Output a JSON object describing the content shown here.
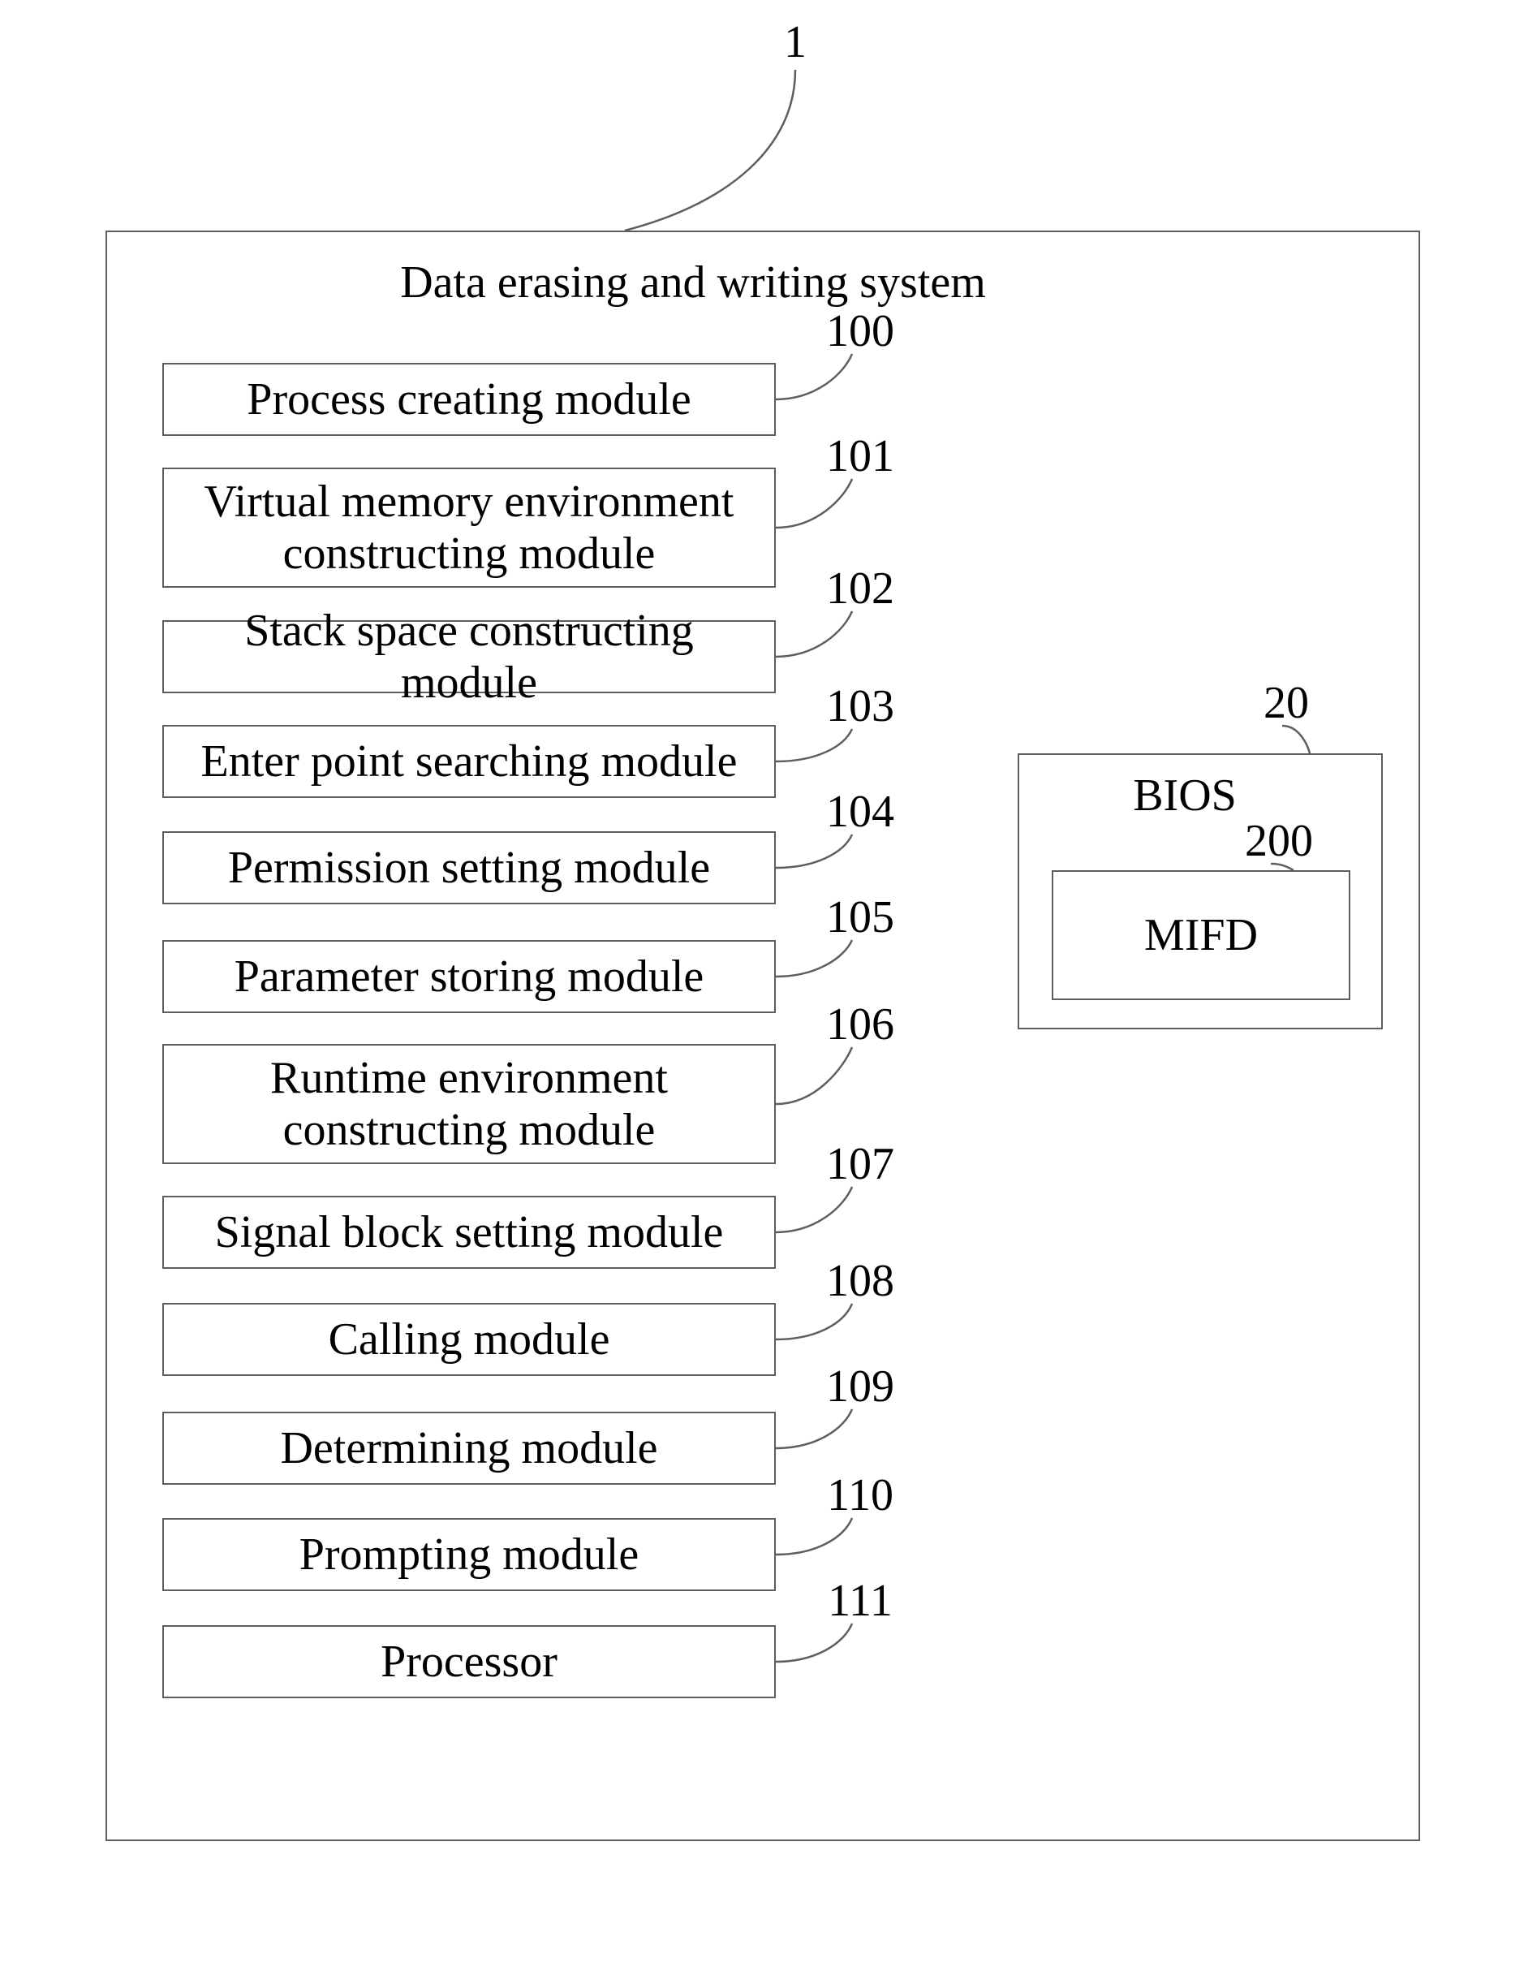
{
  "diagram": {
    "title": "Data erasing and writing system",
    "title_ref": "1",
    "modules": [
      {
        "label": "Process creating module",
        "ref": "100"
      },
      {
        "label": "Virtual memory environment\nconstructing module",
        "ref": "101"
      },
      {
        "label": "Stack space constructing module",
        "ref": "102"
      },
      {
        "label": "Enter point searching module",
        "ref": "103"
      },
      {
        "label": "Permission setting module",
        "ref": "104"
      },
      {
        "label": "Parameter storing module",
        "ref": "105"
      },
      {
        "label": "Runtime environment\nconstructing module",
        "ref": "106"
      },
      {
        "label": "Signal block setting module",
        "ref": "107"
      },
      {
        "label": "Calling module",
        "ref": "108"
      },
      {
        "label": "Determining module",
        "ref": "109"
      },
      {
        "label": "Prompting module",
        "ref": "110"
      },
      {
        "label": "Processor",
        "ref": "111"
      }
    ],
    "bios": {
      "label": "BIOS",
      "ref": "20",
      "inner": {
        "label": "MIFD",
        "ref": "200"
      }
    }
  }
}
